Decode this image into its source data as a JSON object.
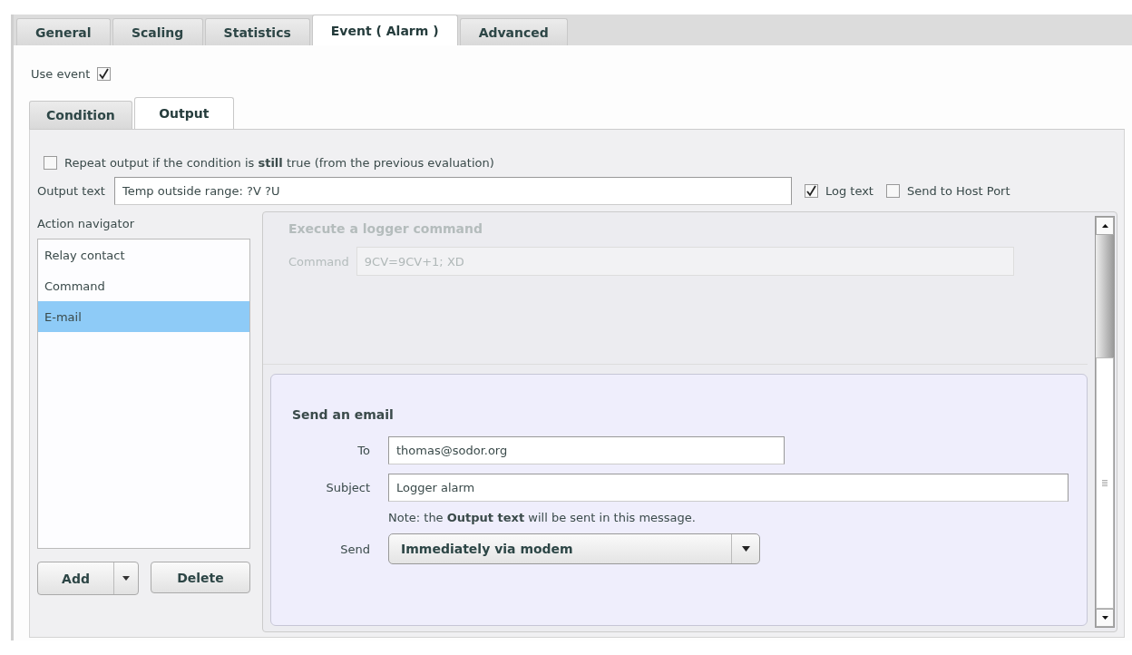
{
  "tabs": [
    {
      "label": "General",
      "selected": false
    },
    {
      "label": "Scaling",
      "selected": false
    },
    {
      "label": "Statistics",
      "selected": false
    },
    {
      "label": "Event ( Alarm )",
      "selected": true
    },
    {
      "label": "Advanced",
      "selected": false
    }
  ],
  "use_event": {
    "label": "Use event",
    "checked": true
  },
  "sub_tabs": [
    {
      "label": "Condition",
      "selected": false
    },
    {
      "label": "Output",
      "selected": true
    }
  ],
  "repeat": {
    "label": "Repeat output if the condition is **still** true (from the previous evaluation)",
    "checked": false
  },
  "output_text": {
    "label": "Output text",
    "value": "Temp outside range: ?V ?U"
  },
  "log_text": {
    "label": "Log text",
    "checked": true
  },
  "send_to_host": {
    "label": "Send to Host Port",
    "checked": false
  },
  "navigator": {
    "label": "Action navigator",
    "items": [
      {
        "label": "Relay contact",
        "selected": false
      },
      {
        "label": "Command",
        "selected": false
      },
      {
        "label": "E-mail",
        "selected": true
      }
    ],
    "add_button": "Add",
    "delete_button": "Delete"
  },
  "command_section": {
    "title": "Execute a logger command",
    "disabled": true,
    "label": "Command",
    "value": "9CV=9CV+1; XD"
  },
  "email_section": {
    "title": "Send an email",
    "disabled": false,
    "to_label": "To",
    "to_value": "thomas@sodor.org",
    "subject_label": "Subject",
    "subject_value": "Logger alarm",
    "note": "Note: the **Output text** will be sent in this message.",
    "send_label": "Send",
    "send_value": "Immediately via modem"
  }
}
